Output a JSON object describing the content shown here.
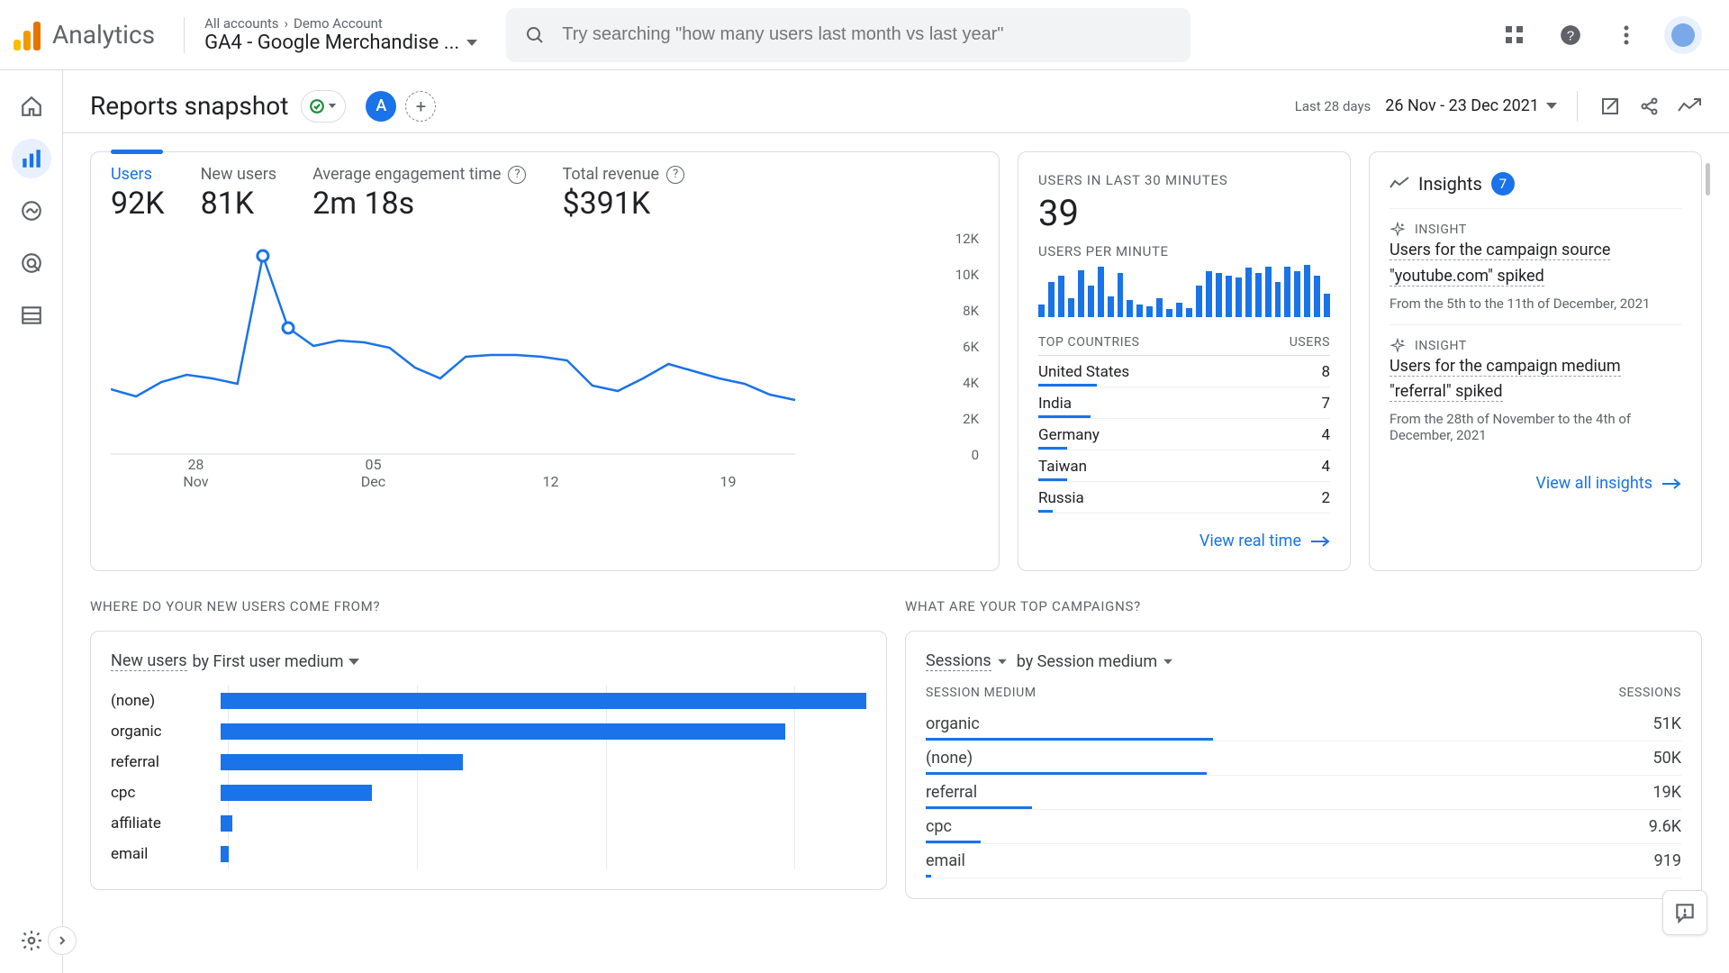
{
  "app_name": "Analytics",
  "breadcrumb": {
    "all": "All accounts",
    "account": "Demo Account"
  },
  "property_name": "GA4 - Google Merchandise ...",
  "search_placeholder": "Try searching \"how many users last month vs last year\"",
  "subhead": {
    "title": "Reports snapshot",
    "badge": "A",
    "last_label": "Last 28 days",
    "range": "26 Nov - 23 Dec 2021"
  },
  "metrics": [
    {
      "label": "Users",
      "value": "92K"
    },
    {
      "label": "New users",
      "value": "81K"
    },
    {
      "label": "Average engagement time",
      "value": "2m 18s",
      "help": true
    },
    {
      "label": "Total revenue",
      "value": "$391K",
      "help": true
    }
  ],
  "chart_data": {
    "type": "line",
    "x_ticks": [
      {
        "line1": "28",
        "line2": "Nov"
      },
      {
        "line1": "05",
        "line2": "Dec"
      },
      {
        "line1": "12",
        "line2": ""
      },
      {
        "line1": "19",
        "line2": ""
      }
    ],
    "y_ticks": [
      "12K",
      "10K",
      "8K",
      "6K",
      "4K",
      "2K",
      "0"
    ],
    "ylim": [
      0,
      12000
    ],
    "xlabel": "",
    "ylabel": "",
    "series": [
      {
        "name": "Users",
        "values": [
          3600,
          3200,
          4000,
          4400,
          4200,
          3900,
          11000,
          7000,
          6000,
          6300,
          6200,
          5900,
          4800,
          4200,
          5400,
          5500,
          5500,
          5400,
          5200,
          3800,
          3500,
          4200,
          5000,
          4600,
          4200,
          3900,
          3300,
          3000
        ]
      }
    ],
    "markers": [
      {
        "index": 6,
        "value": 11000
      },
      {
        "index": 7,
        "value": 7000
      }
    ]
  },
  "realtime": {
    "title": "USERS IN LAST 30 MINUTES",
    "value": "39",
    "sub": "USERS PER MINUTE",
    "bars": [
      12,
      34,
      40,
      18,
      45,
      30,
      48,
      20,
      42,
      16,
      12,
      10,
      18,
      8,
      14,
      9,
      30,
      44,
      42,
      40,
      38,
      47,
      42,
      48,
      34,
      48,
      44,
      50,
      40,
      22
    ],
    "col1": "TOP COUNTRIES",
    "col2": "USERS",
    "rows": [
      {
        "name": "United States",
        "value": "8",
        "bar": 20
      },
      {
        "name": "India",
        "value": "7",
        "bar": 18
      },
      {
        "name": "Germany",
        "value": "4",
        "bar": 10
      },
      {
        "name": "Taiwan",
        "value": "4",
        "bar": 10
      },
      {
        "name": "Russia",
        "value": "2",
        "bar": 5
      }
    ],
    "link": "View real time"
  },
  "insights": {
    "title": "Insights",
    "count": "7",
    "items": [
      {
        "tag": "INSIGHT",
        "text": "Users for the campaign source \"youtube.com\" spiked",
        "date": "From the 5th to the 11th of December, 2021"
      },
      {
        "tag": "INSIGHT",
        "text": "Users for the campaign medium \"referral\" spiked",
        "date": "From the 28th of November to the 4th of December, 2021"
      }
    ],
    "link": "View all insights"
  },
  "section_row2": {
    "left_title": "WHERE DO YOUR NEW USERS COME FROM?",
    "right_title": "WHAT ARE YOUR TOP CAMPAIGNS?"
  },
  "new_users_card": {
    "sel_metric": "New users",
    "sel_by": "by First user medium",
    "max": 32000,
    "rows": [
      {
        "label": "(none)",
        "value": 32000
      },
      {
        "label": "organic",
        "value": 28000
      },
      {
        "label": "referral",
        "value": 12000
      },
      {
        "label": "cpc",
        "value": 7500
      },
      {
        "label": "affiliate",
        "value": 600
      },
      {
        "label": "email",
        "value": 400
      }
    ]
  },
  "campaigns_card": {
    "sel_metric": "Sessions",
    "sel_by": "by Session medium",
    "col1": "SESSION MEDIUM",
    "col2": "SESSIONS",
    "max": 51000,
    "rows": [
      {
        "label": "organic",
        "value": "51K",
        "bar": 100
      },
      {
        "label": "(none)",
        "value": "50K",
        "bar": 98
      },
      {
        "label": "referral",
        "value": "19K",
        "bar": 37
      },
      {
        "label": "cpc",
        "value": "9.6K",
        "bar": 19
      },
      {
        "label": "email",
        "value": "919",
        "bar": 2
      }
    ]
  }
}
